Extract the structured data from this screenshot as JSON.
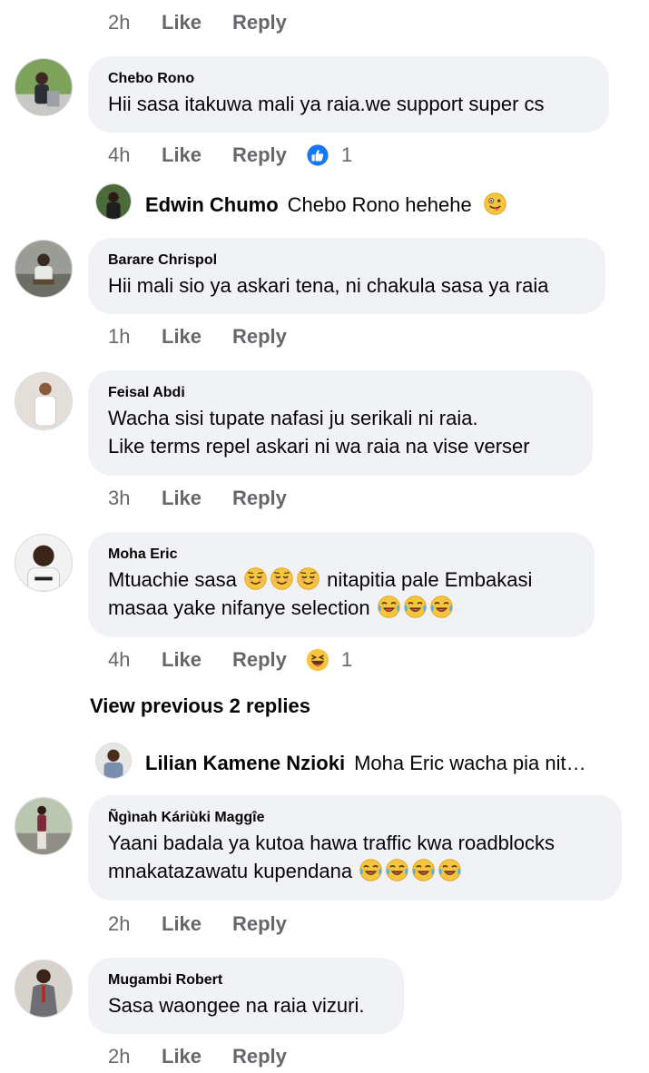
{
  "actions": {
    "like": "Like",
    "reply": "Reply"
  },
  "top_actions": {
    "time": "2h"
  },
  "comments": [
    {
      "name": "Chebo Rono",
      "lines": [
        "Hii sasa itakuwa mali ya raia.we support  super cs"
      ],
      "time": "4h",
      "reaction": {
        "icon": "like-reaction-icon",
        "count": "1"
      }
    },
    {
      "name": "Barare Chrispol",
      "lines": [
        "Hii mali sio ya askari tena, ni chakula sasa ya raia"
      ],
      "time": "1h"
    },
    {
      "name": "Feisal Abdi",
      "lines": [
        "Wacha sisi tupate nafasi ju serikali ni raia.",
        "Like terms repel askari ni wa raia na vise verser"
      ],
      "time": "3h"
    },
    {
      "name": "Moha Eric",
      "lines": [
        "Mtuachie sasa",
        "nitapitia pale Embakasi",
        "masaa yake nifanye selection"
      ],
      "time": "4h",
      "reaction": {
        "icon": "haha-reaction-icon",
        "count": "1"
      }
    },
    {
      "name": "Ñgìnah Káriùki Maggîe",
      "lines": [
        "Yaani badala ya kutoa hawa traffic kwa roadblocks",
        "mnakatazawatu kupendana"
      ],
      "time": "2h"
    },
    {
      "name": "Mugambi Robert",
      "lines": [
        "Sasa waongee na raia vizuri."
      ],
      "time": "2h"
    }
  ],
  "replies": [
    {
      "name": "Edwin Chumo",
      "text": "Chebo Rono hehehe"
    },
    {
      "name": "Lilian Kamene Nzioki",
      "text": "Moha Eric wacha pia nit…"
    }
  ],
  "view_previous": "View previous 2 replies",
  "emoji_icons": {
    "hehehe": "grinning-squint-emoji",
    "moha_first": "relieved-smile-emoji",
    "moha_second": "tears-of-joy-emoji",
    "maggie": "tears-of-joy-emoji"
  },
  "colors": {
    "bubble": "#f0f2f5",
    "meta": "#65676b",
    "like_blue": "#1877f2",
    "text": "#050505"
  }
}
